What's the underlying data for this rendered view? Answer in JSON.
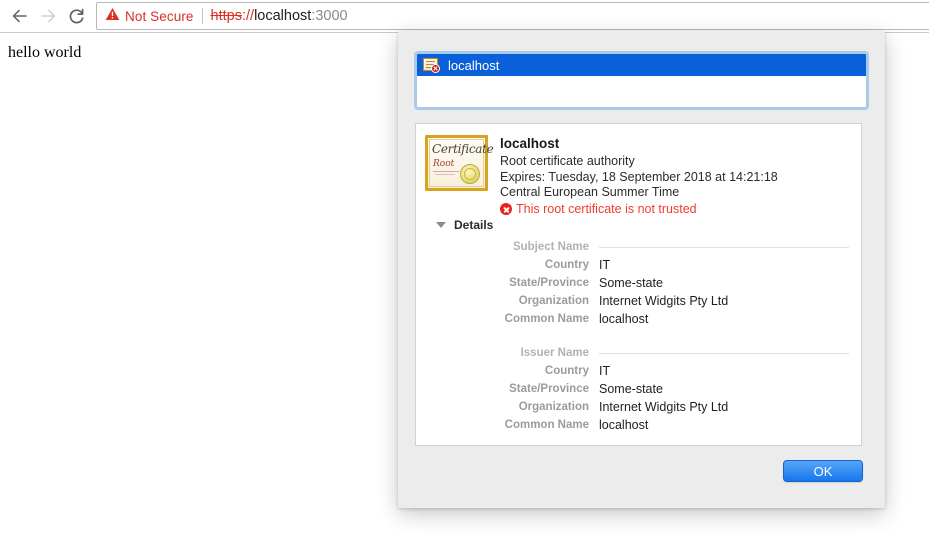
{
  "browser": {
    "back_icon": "arrow-left-icon",
    "forward_icon": "arrow-right-icon",
    "reload_icon": "reload-icon",
    "security": {
      "warning_icon": "warning-triangle-icon",
      "label": "Not Secure",
      "color": "#d93025"
    },
    "url": {
      "scheme": "https",
      "separator": "://",
      "host": "localhost",
      "port": ":3000"
    }
  },
  "page": {
    "body_text": "hello world"
  },
  "dialog": {
    "list": {
      "items": [
        {
          "icon": "certificate-error-icon",
          "label": "localhost",
          "selected": true
        }
      ]
    },
    "grip_icon": "resize-grip-dot",
    "certificate": {
      "icon": "certificate-root-icon",
      "icon_words": {
        "title": "Certificate",
        "subtitle": "Root"
      },
      "name": "localhost",
      "role": "Root certificate authority",
      "expires": "Expires: Tuesday, 18 September 2018 at 14:21:18 Central European Summer Time",
      "trust_icon": "error-circle-icon",
      "trust_status": "This root certificate is not trusted",
      "trust_color": "#f23c2f"
    },
    "details": {
      "disclosure_icon": "triangle-down-icon",
      "label": "Details",
      "expanded": true,
      "sections": [
        {
          "header": "Subject Name",
          "rows": [
            {
              "label": "Country",
              "value": "IT"
            },
            {
              "label": "State/Province",
              "value": "Some-state"
            },
            {
              "label": "Organization",
              "value": "Internet Widgits Pty Ltd"
            },
            {
              "label": "Common Name",
              "value": "localhost"
            }
          ]
        },
        {
          "header": "Issuer Name",
          "rows": [
            {
              "label": "Country",
              "value": "IT"
            },
            {
              "label": "State/Province",
              "value": "Some-state"
            },
            {
              "label": "Organization",
              "value": "Internet Widgits Pty Ltd"
            },
            {
              "label": "Common Name",
              "value": "localhost"
            }
          ]
        }
      ]
    },
    "ok_label": "OK"
  }
}
